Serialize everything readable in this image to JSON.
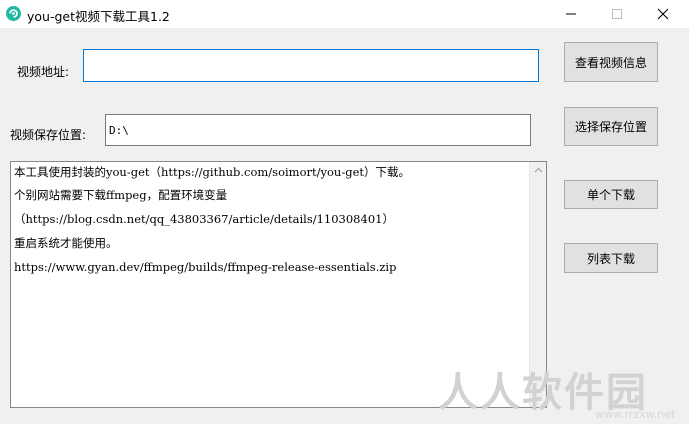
{
  "window": {
    "title": "you-get视频下载工具1.2"
  },
  "form": {
    "url_label": "视频地址:",
    "url_value": "",
    "path_label": "视频保存位置:",
    "path_value": "D:\\"
  },
  "buttons": {
    "view_info": "查看视频信息",
    "choose_path": "选择保存位置",
    "single_download": "单个下载",
    "list_download": "列表下载"
  },
  "log": {
    "lines": [
      "本工具使用封装的you-get（https://github.com/soimort/you-get）下载。",
      "个别网站需要下载ffmpeg，配置环境变量",
      "（https://blog.csdn.net/qq_43803367/article/details/110308401）",
      "重启系统才能使用。",
      "https://www.gyan.dev/ffmpeg/builds/ffmpeg-release-essentials.zip"
    ]
  },
  "watermark": {
    "text": "人人软件园",
    "sub": "www.rrzxw.net"
  },
  "colors": {
    "focus_border": "#0078d7",
    "window_bg": "#f0f0f0",
    "button_bg": "#e1e1e1",
    "app_icon": "#1fb8a0"
  }
}
